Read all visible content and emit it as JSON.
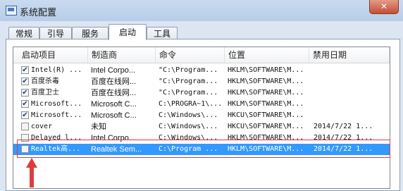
{
  "window": {
    "title": "系统配置",
    "close_label": "✕"
  },
  "tabs": [
    {
      "label": "常规"
    },
    {
      "label": "引导"
    },
    {
      "label": "服务"
    },
    {
      "label": "启动",
      "active": true
    },
    {
      "label": "工具"
    }
  ],
  "table": {
    "columns": [
      "启动项目",
      "制造商",
      "命令",
      "位置",
      "禁用日期"
    ],
    "rows": [
      {
        "checked": true,
        "item": "Intel(R) ...",
        "maker": "Intel Corpo...",
        "command": "\"C:\\Program...",
        "location": "HKLM\\SOFTWARE\\M...",
        "disabled": ""
      },
      {
        "checked": true,
        "item": "百度杀毒",
        "maker": "百度在线网...",
        "command": "\"C:\\Program...",
        "location": "HKLM\\SOFTWARE\\M...",
        "disabled": ""
      },
      {
        "checked": true,
        "item": "百度卫士",
        "maker": "百度在线网...",
        "command": "\"C:\\Program...",
        "location": "HKLM\\SOFTWARE\\M...",
        "disabled": ""
      },
      {
        "checked": true,
        "item": "Microsoft...",
        "maker": "Microsoft C...",
        "command": "C:\\PROGRA~1\\...",
        "location": "HKLM\\SOFTWARE\\M...",
        "disabled": ""
      },
      {
        "checked": true,
        "item": "Microsoft...",
        "maker": "Microsoft C...",
        "command": "C:\\Windows\\...",
        "location": "HKCU\\SOFTWARE\\M...",
        "disabled": ""
      },
      {
        "checked": false,
        "item": "cover",
        "maker": "未知",
        "command": "C:\\Windows\\...",
        "location": "HKCU\\SOFTWARE\\M...",
        "disabled": "2014/7/22 1..."
      },
      {
        "checked": false,
        "item": "Delayed l...",
        "maker": "Intel Corpo...",
        "command": "C:\\Windows\\...",
        "location": "HKLM\\SOFTWARE\\M...",
        "disabled": "2014/7/22 1..."
      },
      {
        "checked": false,
        "item": "Realtek高...",
        "maker": "Realtek Sem...",
        "command": "C:\\Program ...",
        "location": "HKLM\\SOFTWARE\\M...",
        "disabled": "2014/7/22 1...",
        "selected": true
      }
    ]
  },
  "colors": {
    "selection": "#3399ff",
    "annotation": "#e03b3b"
  }
}
